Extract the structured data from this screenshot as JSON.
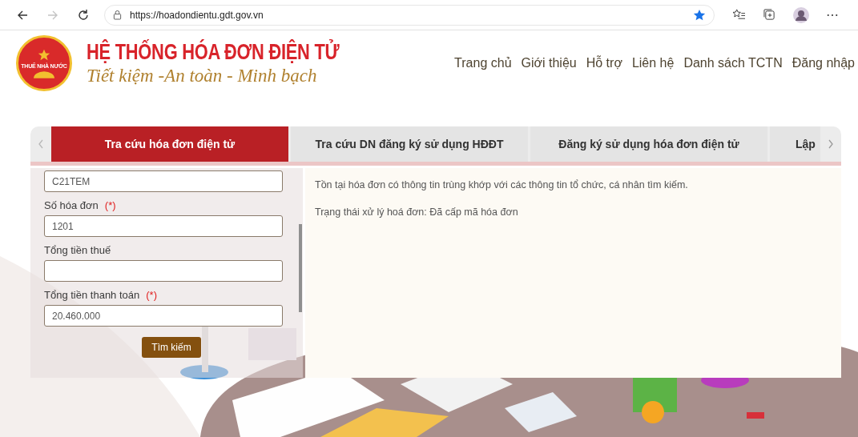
{
  "browser": {
    "url": "https://hoadondientu.gdt.gov.vn",
    "forward_disabled": true,
    "bookmarked": true
  },
  "header": {
    "logo_text": "THUẾ NHÀ NƯỚC",
    "title": "HỆ THỐNG HÓA ĐƠN ĐIỆN TỬ",
    "slogan": "Tiết kiệm -An toàn - Minh bạch",
    "nav": [
      "Trang chủ",
      "Giới thiệu",
      "Hỗ trợ",
      "Liên hệ",
      "Danh sách TCTN",
      "Đăng nhập"
    ]
  },
  "tabs": [
    {
      "label": "Tra cứu hóa đơn điện tử",
      "selected": true
    },
    {
      "label": "Tra cứu DN đăng ký sử dụng HĐĐT",
      "selected": false
    },
    {
      "label": "Đăng ký sử dụng hóa đơn điện tử",
      "selected": false
    },
    {
      "label": "Lập",
      "selected": false
    }
  ],
  "form": {
    "fields": [
      {
        "value": "C21TEM"
      },
      {
        "label": "Số hóa đơn",
        "required_mark": "(*)",
        "value": "1201"
      },
      {
        "label": "Tổng tiền thuế"
      },
      {
        "label": "Tổng tiền thanh toán",
        "required_mark": "(*)",
        "value": "20.460.000"
      }
    ],
    "submit": "Tìm kiếm"
  },
  "result": {
    "messages": [
      "Tồn tại hóa đơn có thông tin trùng khớp với các thông tin tổ chức, cá nhân tìm kiếm.",
      "Trạng thái xử lý hoá đơn: Đã cấp mã hóa đơn"
    ]
  }
}
